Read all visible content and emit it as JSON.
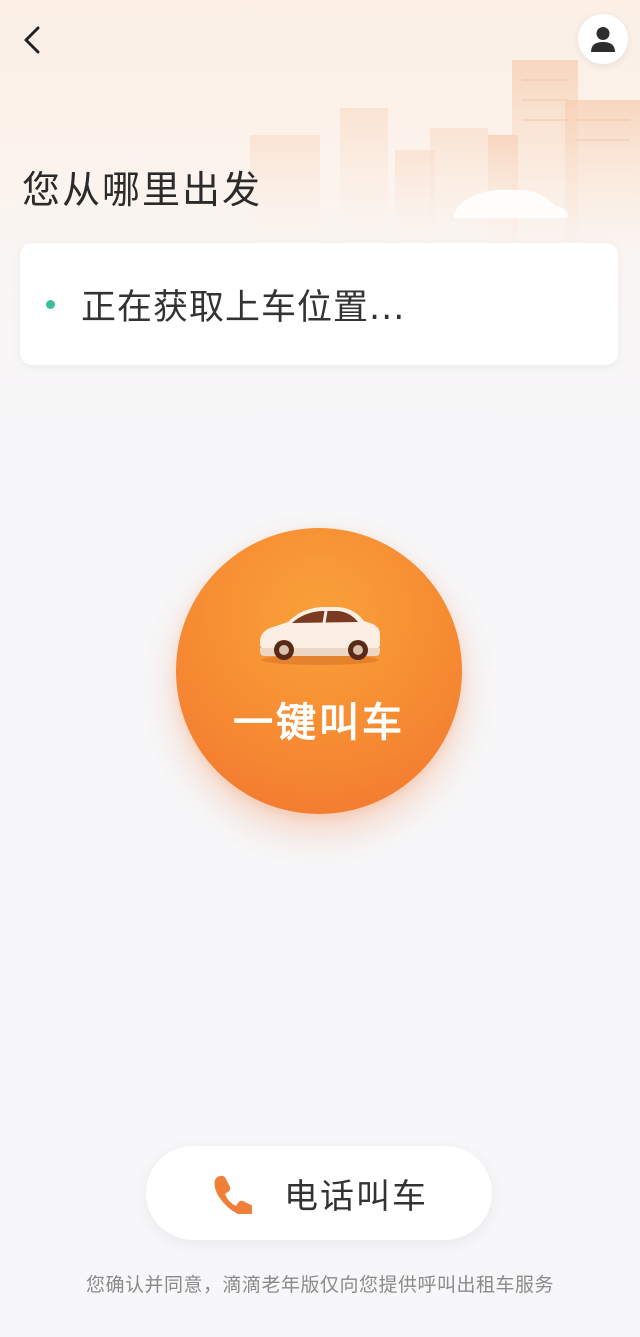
{
  "header": {
    "back_icon": "chevron-left-icon",
    "account_icon": "user-icon"
  },
  "main": {
    "title": "您从哪里出发",
    "location_status": "正在获取上车位置...",
    "call_button_label": "一键叫车",
    "call_button_icon": "car-icon"
  },
  "footer": {
    "phone_button_label": "电话叫车",
    "phone_button_icon": "phone-icon",
    "disclaimer": "您确认并同意，滴滴老年版仅向您提供呼叫出租车服务"
  },
  "colors": {
    "accent_orange": "#f68a32",
    "status_dot": "#3bbf9a",
    "text_primary": "#333333",
    "text_secondary": "#8a8a8a"
  }
}
